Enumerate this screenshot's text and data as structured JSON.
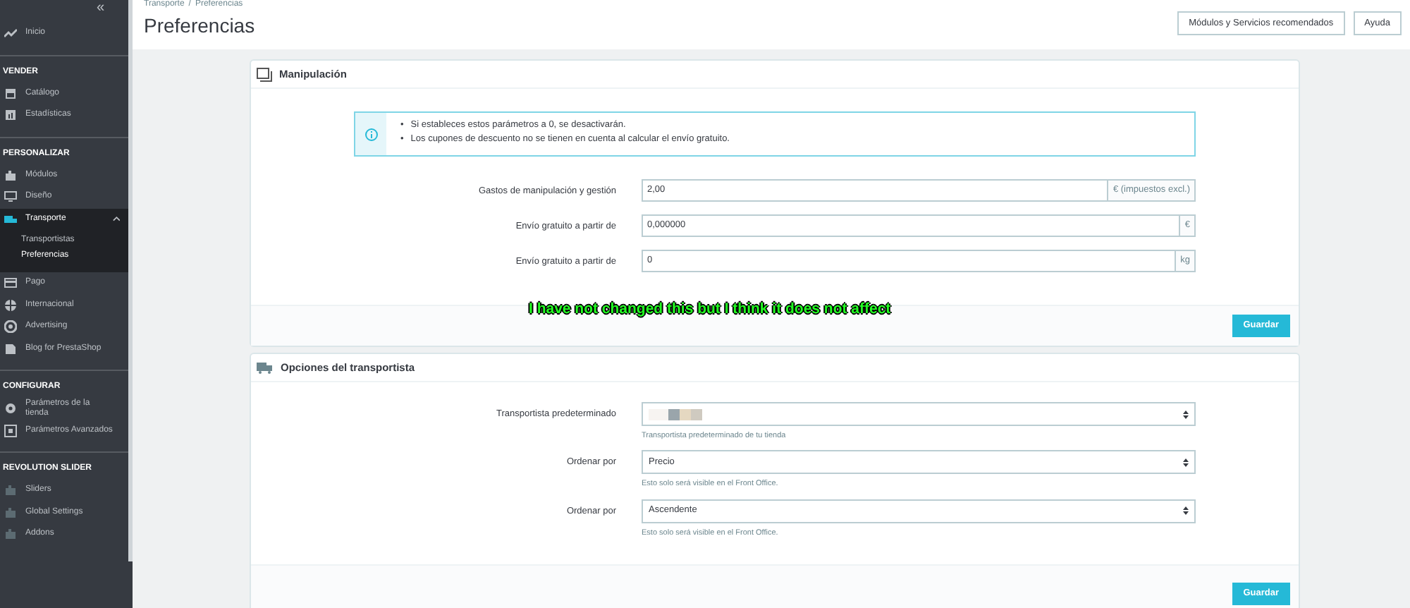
{
  "sidebar": {
    "collapse": "«",
    "sections": [
      {
        "items": [
          {
            "label": "Inicio",
            "selected": false
          }
        ]
      },
      {
        "title": "VENDER",
        "items": [
          {
            "label": "Catálogo",
            "selected": false
          },
          {
            "label": "Estadísticas",
            "selected": false
          }
        ]
      },
      {
        "title": "PERSONALIZAR",
        "items": [
          {
            "label": "Módulos",
            "selected": false
          },
          {
            "label": "Diseño",
            "selected": false
          },
          {
            "label": "Transporte",
            "selected": true,
            "expanded": true,
            "children": [
              {
                "label": "Transportistas",
                "selected": false
              },
              {
                "label": "Preferencias",
                "selected": true
              }
            ]
          },
          {
            "label": "Pago",
            "selected": false
          },
          {
            "label": "Internacional",
            "selected": false
          },
          {
            "label": "Advertising",
            "selected": false
          },
          {
            "label": "Blog for PrestaShop",
            "selected": false
          }
        ]
      },
      {
        "title": "CONFIGURAR",
        "items": [
          {
            "label": "Parámetros de la tienda",
            "selected": false
          },
          {
            "label": "Parámetros Avanzados",
            "selected": false
          }
        ]
      },
      {
        "title": "REVOLUTION SLIDER",
        "items": [
          {
            "label": "Sliders",
            "selected": false
          },
          {
            "label": "Global Settings",
            "selected": false
          },
          {
            "label": "Addons",
            "selected": false
          }
        ]
      }
    ]
  },
  "header": {
    "breadcrumb": [
      "Transporte",
      "Preferencias"
    ],
    "separator": "/",
    "title": "Preferencias",
    "buttons": [
      "Módulos y Servicios recomendados",
      "Ayuda"
    ]
  },
  "panels": [
    {
      "title": "Manipulación",
      "bullet": "•",
      "info": [
        "Si estableces estos parámetros a 0, se desactivarán.",
        "Los cupones de descuento no se tienen en cuenta al calcular el envío gratuito."
      ],
      "fields": [
        {
          "kind": "input",
          "label": "Gastos de manipulación y gestión",
          "value": "2,00",
          "addon": "€ (impuestos excl.)"
        },
        {
          "kind": "input",
          "label": "Envío gratuito a partir de",
          "value": "0,000000",
          "addon": "€"
        },
        {
          "kind": "input",
          "label": "Envío gratuito a partir de",
          "value": "0",
          "addon": "kg"
        }
      ],
      "save": "Guardar"
    },
    {
      "title": "Opciones del transportista",
      "fields": [
        {
          "kind": "redacted-select",
          "label": "Transportista predeterminado",
          "help": "Transportista predeterminado de tu tienda"
        },
        {
          "kind": "select",
          "label": "Ordenar por",
          "value": "Precio",
          "help": "Esto solo será visible en el Front Office."
        },
        {
          "kind": "select",
          "label": "Ordenar por",
          "value": "Ascendente",
          "help": "Esto solo será visible en el Front Office."
        }
      ],
      "save": "Guardar"
    }
  ],
  "annotation": "I have not changed this but I think it does not affect"
}
